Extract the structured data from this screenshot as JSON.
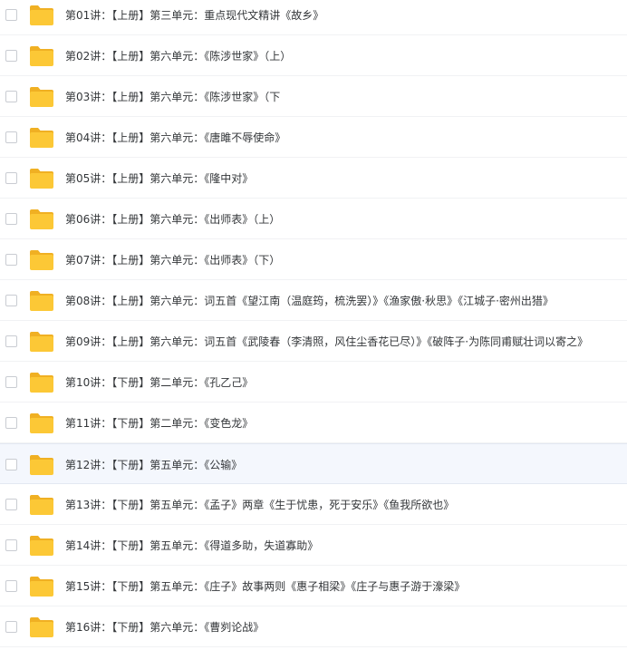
{
  "colors": {
    "folder_front": "#fcc836",
    "folder_back": "#f0b023",
    "row_hover_bg": "#f4f7fd"
  },
  "list": {
    "hovered_index": 11,
    "items": [
      {
        "name": "第01讲：【上册】第三单元：重点现代文精讲《故乡》",
        "icon": "folder-icon",
        "checked": false
      },
      {
        "name": "第02讲：【上册】第六单元：《陈涉世家》（上）",
        "icon": "folder-icon",
        "checked": false
      },
      {
        "name": "第03讲：【上册】第六单元：《陈涉世家》（下",
        "icon": "folder-icon",
        "checked": false
      },
      {
        "name": "第04讲：【上册】第六单元：《唐雎不辱使命》",
        "icon": "folder-icon",
        "checked": false
      },
      {
        "name": "第05讲：【上册】第六单元：《隆中对》",
        "icon": "folder-icon",
        "checked": false
      },
      {
        "name": "第06讲：【上册】第六单元：《出师表》（上）",
        "icon": "folder-icon",
        "checked": false
      },
      {
        "name": "第07讲：【上册】第六单元：《出师表》（下）",
        "icon": "folder-icon",
        "checked": false
      },
      {
        "name": "第08讲：【上册】第六单元：词五首《望江南（温庭筠，梳洗罢）》《渔家傲·秋思》《江城子·密州出猎》",
        "icon": "folder-icon",
        "checked": false
      },
      {
        "name": "第09讲：【上册】第六单元：词五首《武陵春（李清照，风住尘香花已尽）》《破阵子·为陈同甫赋壮词以寄之》",
        "icon": "folder-icon",
        "checked": false
      },
      {
        "name": "第10讲：【下册】第二单元：《孔乙己》",
        "icon": "folder-icon",
        "checked": false
      },
      {
        "name": "第11讲：【下册】第二单元：《变色龙》",
        "icon": "folder-icon",
        "checked": false
      },
      {
        "name": "第12讲：【下册】第五单元：《公输》",
        "icon": "folder-icon",
        "checked": false
      },
      {
        "name": "第13讲：【下册】第五单元：《孟子》两章《生于忧患，死于安乐》《鱼我所欲也》",
        "icon": "folder-icon",
        "checked": false
      },
      {
        "name": "第14讲：【下册】第五单元：《得道多助，失道寡助》",
        "icon": "folder-icon",
        "checked": false
      },
      {
        "name": "第15讲：【下册】第五单元：《庄子》故事两则《惠子相梁》《庄子与惠子游于濠梁》",
        "icon": "folder-icon",
        "checked": false
      },
      {
        "name": "第16讲：【下册】第六单元：《曹刿论战》",
        "icon": "folder-icon",
        "checked": false
      }
    ]
  }
}
